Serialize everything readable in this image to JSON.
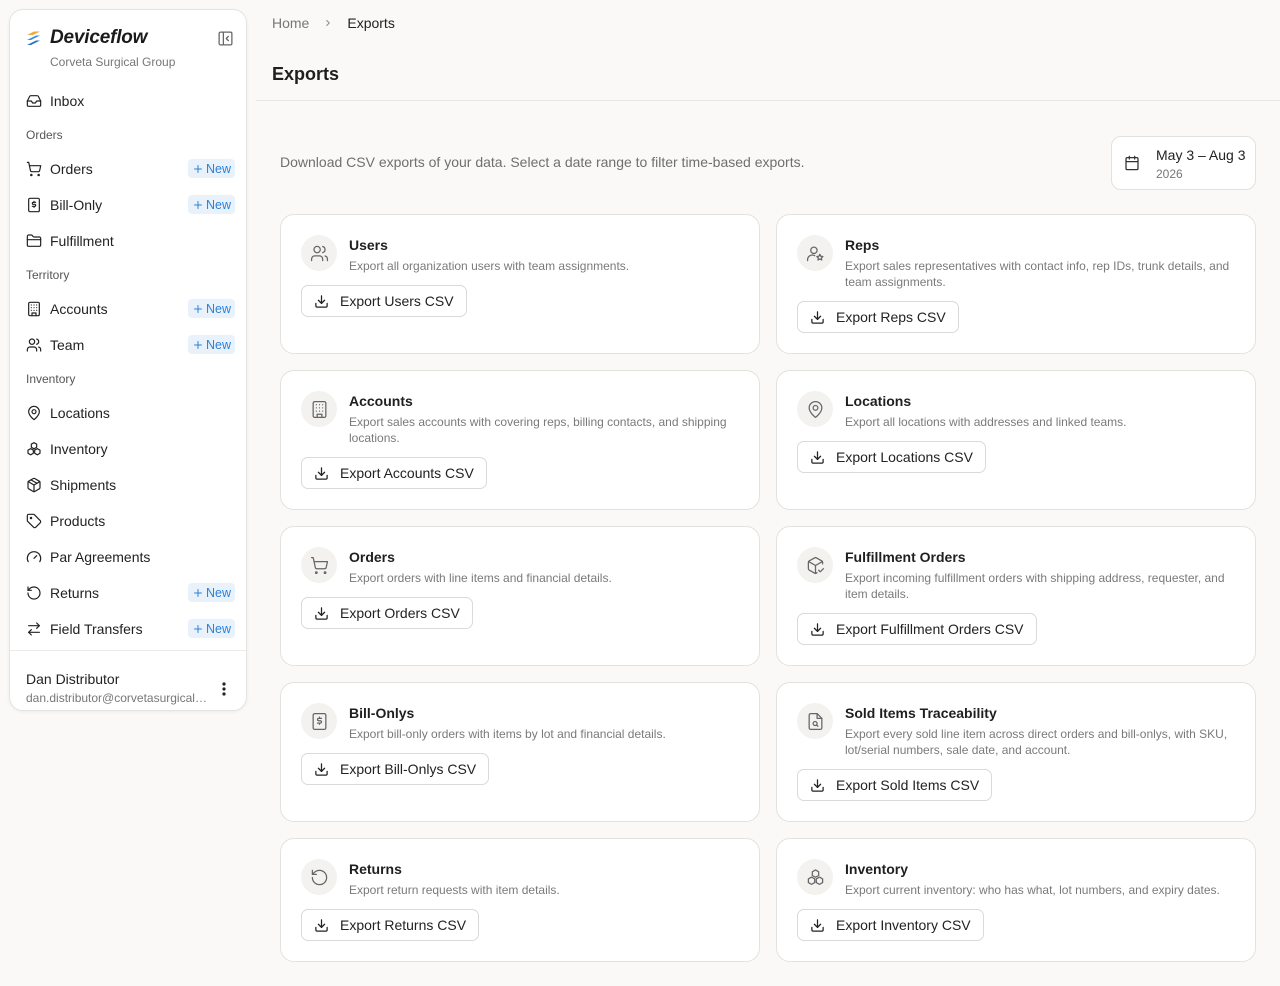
{
  "brand": {
    "name": "Deviceflow",
    "org": "Corveta Surgical Group"
  },
  "sidebar": {
    "items": [
      {
        "type": "item",
        "label": "Inbox",
        "icon": "inbox-icon"
      },
      {
        "type": "group",
        "label": "Orders"
      },
      {
        "type": "item",
        "label": "Orders",
        "icon": "cart-icon",
        "badge": "New"
      },
      {
        "type": "item",
        "label": "Bill-Only",
        "icon": "receipt-icon",
        "badge": "New"
      },
      {
        "type": "item",
        "label": "Fulfillment",
        "icon": "folder-icon"
      },
      {
        "type": "group",
        "label": "Territory"
      },
      {
        "type": "item",
        "label": "Accounts",
        "icon": "building-icon",
        "badge": "New"
      },
      {
        "type": "item",
        "label": "Team",
        "icon": "users-icon",
        "badge": "New"
      },
      {
        "type": "group",
        "label": "Inventory"
      },
      {
        "type": "item",
        "label": "Locations",
        "icon": "map-pin-icon"
      },
      {
        "type": "item",
        "label": "Inventory",
        "icon": "boxes-icon"
      },
      {
        "type": "item",
        "label": "Shipments",
        "icon": "package-icon"
      },
      {
        "type": "item",
        "label": "Products",
        "icon": "tag-icon"
      },
      {
        "type": "item",
        "label": "Par Agreements",
        "icon": "gauge-icon"
      },
      {
        "type": "item",
        "label": "Returns",
        "icon": "rotate-ccw-icon",
        "badge": "New"
      },
      {
        "type": "item",
        "label": "Field Transfers",
        "icon": "transfer-icon",
        "badge": "New"
      }
    ]
  },
  "user": {
    "name": "Dan Distributor",
    "email": "dan.distributor@corvetasurgical.com"
  },
  "breadcrumb": {
    "home": "Home",
    "current": "Exports"
  },
  "page": {
    "title": "Exports",
    "intro": "Download CSV exports of your data. Select a date range to filter time-based exports.",
    "date_range": "May 3 – Aug 3",
    "date_year": "2026"
  },
  "cards": [
    {
      "title": "Users",
      "desc": "Export all organization users with team assignments.",
      "button": "Export Users CSV",
      "icon": "users-icon"
    },
    {
      "title": "Reps",
      "desc": "Export sales representatives with contact info, rep IDs, trunk details, and team assignments.",
      "button": "Export Reps CSV",
      "icon": "user-star-icon"
    },
    {
      "title": "Accounts",
      "desc": "Export sales accounts with covering reps, billing contacts, and shipping locations.",
      "button": "Export Accounts CSV",
      "icon": "building-icon"
    },
    {
      "title": "Locations",
      "desc": "Export all locations with addresses and linked teams.",
      "button": "Export Locations CSV",
      "icon": "map-pin-icon"
    },
    {
      "title": "Orders",
      "desc": "Export orders with line items and financial details.",
      "button": "Export Orders CSV",
      "icon": "cart-icon"
    },
    {
      "title": "Fulfillment Orders",
      "desc": "Export incoming fulfillment orders with shipping address, requester, and item details.",
      "button": "Export Fulfillment Orders CSV",
      "icon": "package-check-icon"
    },
    {
      "title": "Bill-Onlys",
      "desc": "Export bill-only orders with items by lot and financial details.",
      "button": "Export Bill-Onlys CSV",
      "icon": "receipt-icon"
    },
    {
      "title": "Sold Items Traceability",
      "desc": "Export every sold line item across direct orders and bill-onlys, with SKU, lot/serial numbers, sale date, and account.",
      "button": "Export Sold Items CSV",
      "icon": "file-search-icon"
    },
    {
      "title": "Returns",
      "desc": "Export return requests with item details.",
      "button": "Export Returns CSV",
      "icon": "rotate-ccw-icon"
    },
    {
      "title": "Inventory",
      "desc": "Export current inventory: who has what, lot numbers, and expiry dates.",
      "button": "Export Inventory CSV",
      "icon": "boxes-icon"
    }
  ]
}
